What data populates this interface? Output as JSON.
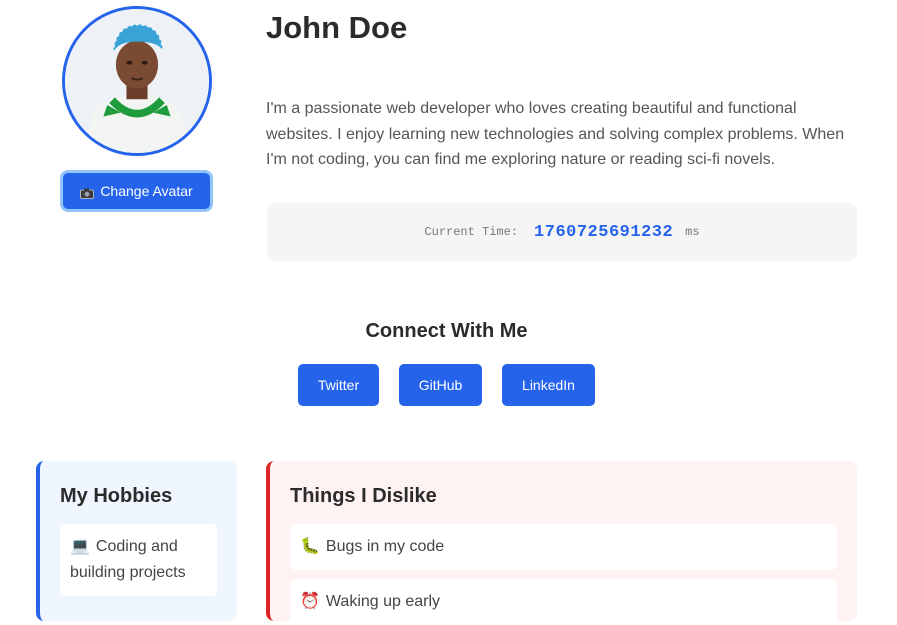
{
  "profile": {
    "name": "John Doe",
    "bio": "I'm a passionate web developer who loves creating beautiful and functional websites. I enjoy learning new technologies and solving complex problems. When I'm not coding, you can find me exploring nature or reading sci-fi novels.",
    "change_avatar_label": "Change Avatar",
    "change_avatar_icon": "camera-icon"
  },
  "time": {
    "label": "Current Time:",
    "value": "1760725691232",
    "unit": "ms"
  },
  "connect": {
    "title": "Connect With Me",
    "links": [
      "Twitter",
      "GitHub",
      "LinkedIn"
    ]
  },
  "hobbies": {
    "title": "My Hobbies",
    "items": [
      {
        "icon": "💻",
        "icon_name": "laptop-icon",
        "text": "Coding and building projects"
      }
    ]
  },
  "dislikes": {
    "title": "Things I Dislike",
    "items": [
      {
        "icon": "🐛",
        "icon_name": "bug-icon",
        "text": "Bugs in my code"
      },
      {
        "icon": "⏰",
        "icon_name": "alarm-clock-icon",
        "text": "Waking up early"
      }
    ]
  },
  "colors": {
    "accent": "#2563eb",
    "dislike_accent": "#dc2626",
    "hobbies_bg": "#eff6ff",
    "dislikes_bg": "#fef2f2"
  }
}
